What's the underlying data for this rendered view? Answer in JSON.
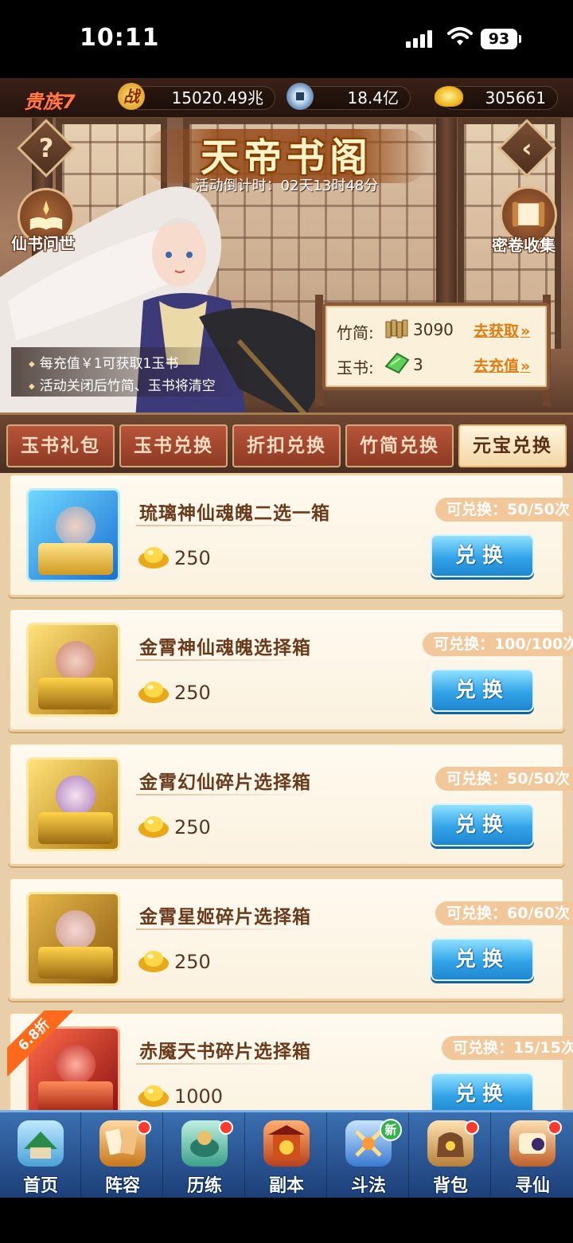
{
  "status_bar": {
    "time": "10:11",
    "battery": "93"
  },
  "resources": {
    "vip": "贵族7",
    "power_icon_text": "战",
    "power": "15020.49兆",
    "coins": "18.4亿",
    "ingots": "305661"
  },
  "event": {
    "title": "天帝书阁",
    "countdown": "活动倒计时：02天13时48分",
    "help_icon": "?",
    "left_feature": "仙书问世",
    "right_feature": "密卷收集",
    "notes": [
      "每充值￥1可获取1玉书",
      "活动关闭后竹简、玉书将清空"
    ],
    "bamboo_label": "竹简:",
    "bamboo_value": "3090",
    "bamboo_link": "去获取",
    "jade_label": "玉书:",
    "jade_value": "3",
    "jade_link": "去充值"
  },
  "tabs": [
    "玉书礼包",
    "玉书兑换",
    "折扣兑换",
    "竹简兑换",
    "元宝兑换"
  ],
  "active_tab": "元宝兑换",
  "items": [
    {
      "name": "琉璃神仙魂魄二选一箱",
      "cost": "250",
      "limit": "可兑换：50/50次",
      "button": "兑换"
    },
    {
      "name": "金霄神仙魂魄选择箱",
      "cost": "250",
      "limit": "可兑换：100/100次",
      "button": "兑换"
    },
    {
      "name": "金霄幻仙碎片选择箱",
      "cost": "250",
      "limit": "可兑换：50/50次",
      "button": "兑换"
    },
    {
      "name": "金霄星姬碎片选择箱",
      "cost": "250",
      "limit": "可兑换：60/60次",
      "button": "兑换"
    },
    {
      "name": "赤魇天书碎片选择箱",
      "cost": "1000",
      "limit": "可兑换：15/15次",
      "button": "兑换",
      "discount": "6.8折"
    }
  ],
  "nav": [
    {
      "label": "首页",
      "icon": "home-icon",
      "badge": ""
    },
    {
      "label": "阵容",
      "icon": "lineup-icon",
      "badge": "dot"
    },
    {
      "label": "历练",
      "icon": "training-icon",
      "badge": "dot"
    },
    {
      "label": "副本",
      "icon": "dungeon-icon",
      "badge": ""
    },
    {
      "label": "斗法",
      "icon": "arena-icon",
      "badge": "新"
    },
    {
      "label": "背包",
      "icon": "bag-icon",
      "badge": "dot"
    },
    {
      "label": "寻仙",
      "icon": "seek-immortal-icon",
      "badge": "dot"
    }
  ],
  "colors": {
    "accent_blue": "#33a4e8",
    "tab_red": "#8e3a24",
    "link_orange": "#e07c12"
  }
}
